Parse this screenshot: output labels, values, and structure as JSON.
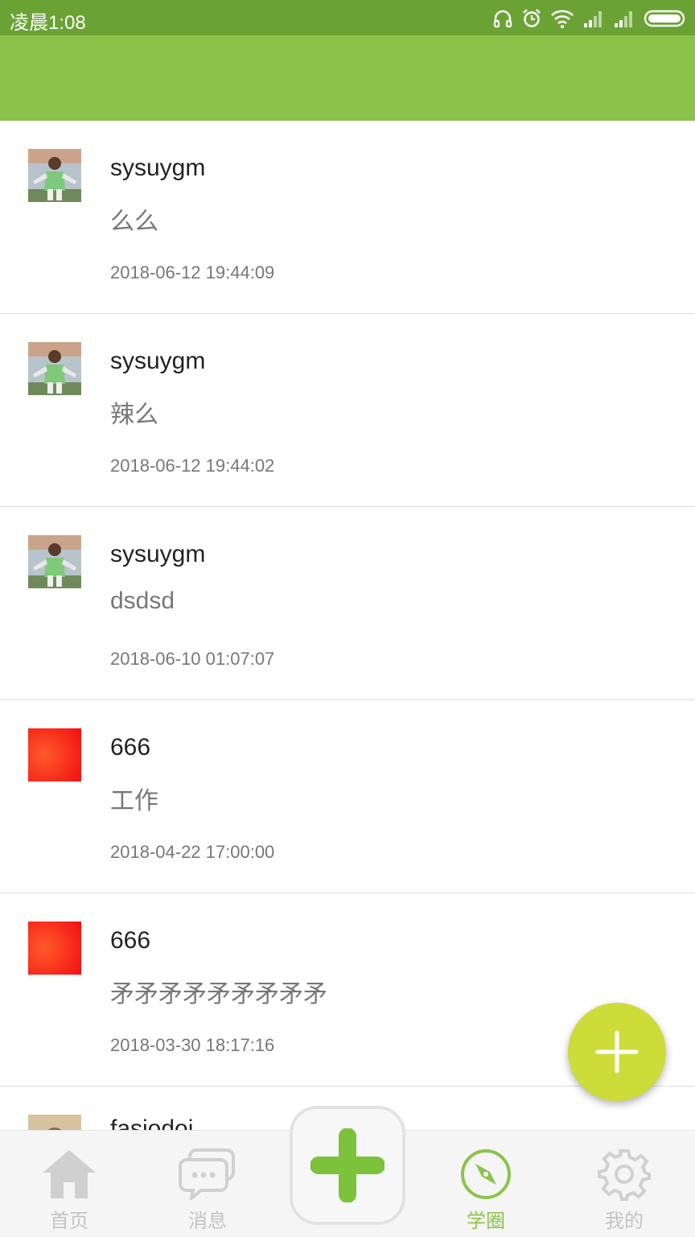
{
  "status_bar": {
    "time": "凌晨1:08",
    "icons": [
      "headset-icon",
      "alarm-icon",
      "wifi-icon",
      "signal-icon",
      "signal-icon",
      "battery-icon"
    ]
  },
  "colors": {
    "status_bar": "#6aa334",
    "app_bar": "#8bc34a",
    "accent": "#8bc34a",
    "fab": "#cddc39"
  },
  "feed": {
    "items": [
      {
        "user": "sysuygm",
        "text": "么么",
        "time": "2018-06-12 19:44:09",
        "avatar": "photo-avatar"
      },
      {
        "user": "sysuygm",
        "text": "辣么",
        "time": "2018-06-12 19:44:02",
        "avatar": "photo-avatar"
      },
      {
        "user": "sysuygm",
        "text": "dsdsd",
        "time": "2018-06-10 01:07:07",
        "avatar": "photo-avatar"
      },
      {
        "user": "666",
        "text": "工作",
        "time": "2018-04-22 17:00:00",
        "avatar": "red-avatar"
      },
      {
        "user": "666",
        "text": "矛矛矛矛矛矛矛矛矛",
        "time": "2018-03-30 18:17:16",
        "avatar": "red-avatar"
      }
    ],
    "partial_user": "fasiodoi"
  },
  "fab": {
    "icon": "plus-icon"
  },
  "bottom_nav": {
    "items": [
      {
        "label": "首页",
        "icon": "home-icon"
      },
      {
        "label": "消息",
        "icon": "chat-icon"
      },
      {
        "label": "学圈",
        "icon": "compass-icon",
        "active": true
      },
      {
        "label": "我的",
        "icon": "gear-icon"
      }
    ],
    "center_icon": "plus-icon"
  }
}
